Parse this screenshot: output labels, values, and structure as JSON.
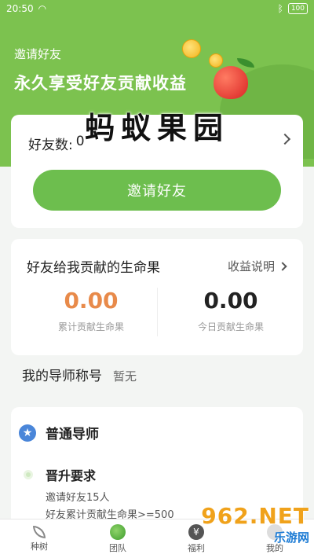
{
  "status_bar": {
    "time": "20:50",
    "battery": "100"
  },
  "header": {
    "subtitle": "邀请好友",
    "headline": "永久享受好友贡献收益"
  },
  "watermark_title": "蚂蚁果园",
  "friends": {
    "label": "好友数:",
    "count": "0",
    "invite_button": "邀请好友"
  },
  "contribution": {
    "title": "好友给我贡献的生命果",
    "link": "收益说明",
    "total_value": "0.00",
    "total_label": "累计贡献生命果",
    "today_value": "0.00",
    "today_label": "今日贡献生命果"
  },
  "mentor": {
    "label": "我的导师称号",
    "value": "暂无"
  },
  "mentor_card": {
    "name": "普通导师",
    "requirement_title": "晋升要求",
    "requirement_1": "邀请好友15人",
    "requirement_2": "好友累计贡献生命果>=500"
  },
  "nav": {
    "items": [
      {
        "label": "种树",
        "icon": "leaf-icon"
      },
      {
        "label": "团队",
        "icon": "apple-icon"
      },
      {
        "label": "福利",
        "icon": "yen-icon"
      },
      {
        "label": "我的",
        "icon": "user-icon"
      }
    ]
  },
  "site_watermark": {
    "big": "962.NET",
    "small": "乐游网"
  },
  "colors": {
    "primary_green": "#7cc24f",
    "button_green": "#6dbe4e",
    "accent_orange": "#e88a4a"
  }
}
